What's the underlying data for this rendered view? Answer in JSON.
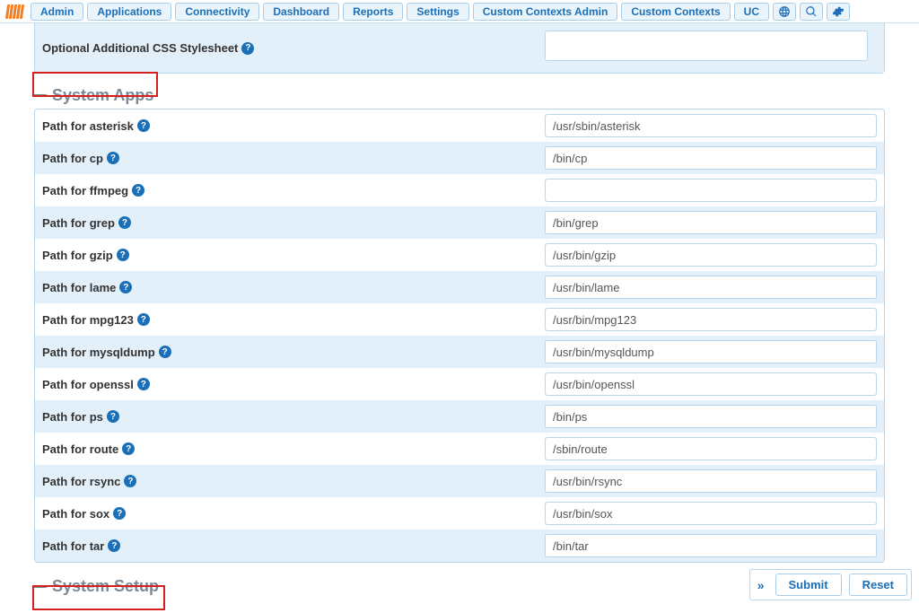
{
  "nav": {
    "items": [
      "Admin",
      "Applications",
      "Connectivity",
      "Dashboard",
      "Reports",
      "Settings",
      "Custom Contexts Admin",
      "Custom Contexts",
      "UC"
    ]
  },
  "top_panel": {
    "css_label": "Optional Additional CSS Stylesheet"
  },
  "sections": {
    "system_apps": {
      "title": "System Apps",
      "rows": [
        {
          "label": "Path for asterisk",
          "value": "/usr/sbin/asterisk"
        },
        {
          "label": "Path for cp",
          "value": "/bin/cp"
        },
        {
          "label": "Path for ffmpeg",
          "value": ""
        },
        {
          "label": "Path for grep",
          "value": "/bin/grep"
        },
        {
          "label": "Path for gzip",
          "value": "/usr/bin/gzip"
        },
        {
          "label": "Path for lame",
          "value": "/usr/bin/lame"
        },
        {
          "label": "Path for mpg123",
          "value": "/usr/bin/mpg123"
        },
        {
          "label": "Path for mysqldump",
          "value": "/usr/bin/mysqldump"
        },
        {
          "label": "Path for openssl",
          "value": "/usr/bin/openssl"
        },
        {
          "label": "Path for ps",
          "value": "/bin/ps"
        },
        {
          "label": "Path for route",
          "value": "/sbin/route"
        },
        {
          "label": "Path for rsync",
          "value": "/usr/bin/rsync"
        },
        {
          "label": "Path for sox",
          "value": "/usr/bin/sox"
        },
        {
          "label": "Path for tar",
          "value": "/bin/tar"
        }
      ]
    },
    "system_setup": {
      "title": "System Setup"
    }
  },
  "actions": {
    "submit": "Submit",
    "reset": "Reset"
  }
}
